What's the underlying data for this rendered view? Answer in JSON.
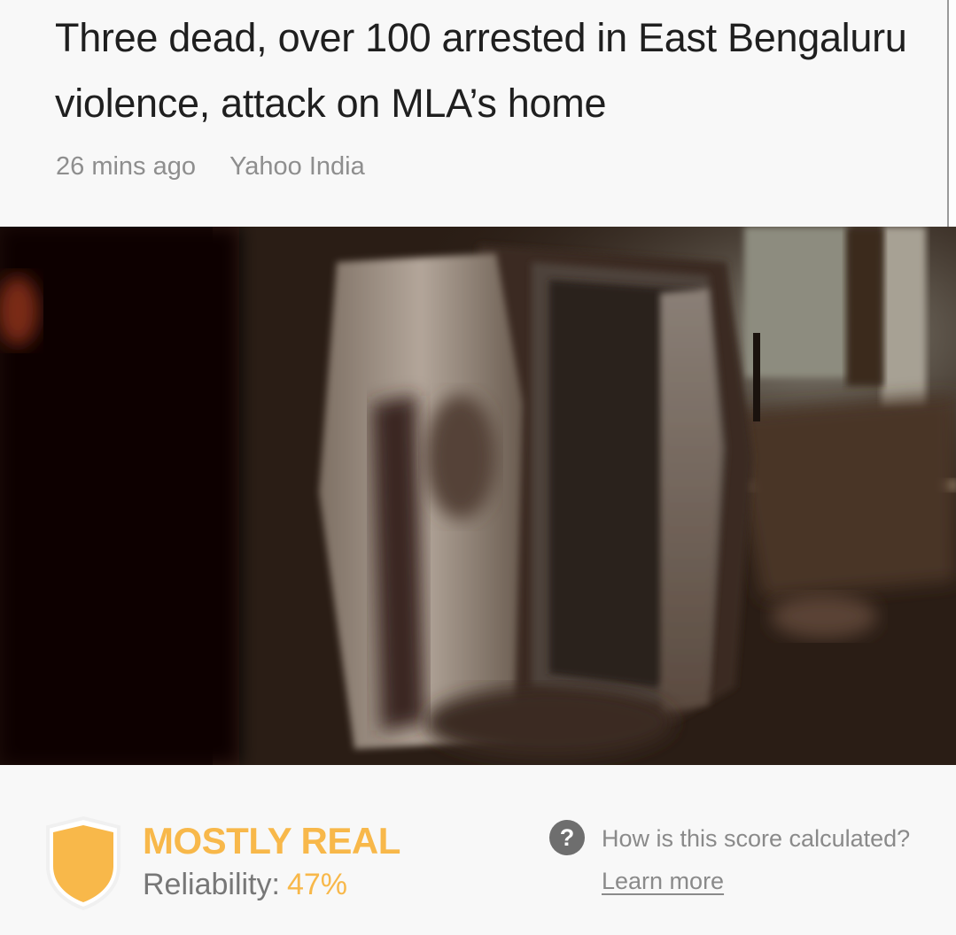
{
  "article": {
    "headline": "Three dead, over 100 arrested in East Bengaluru violence, attack on MLA’s home",
    "time_ago": "26 mins ago",
    "source": "Yahoo India"
  },
  "rating": {
    "verdict": "MOSTLY REAL",
    "reliability_label": "Reliability:",
    "reliability_value": "47%",
    "reliability_fraction": 0.47,
    "accent_color": "#f8b84a",
    "shield_icon": "shield-icon"
  },
  "help": {
    "icon": "question-circle-icon",
    "question": "How is this score calculated?",
    "learn_more": "Learn more"
  }
}
